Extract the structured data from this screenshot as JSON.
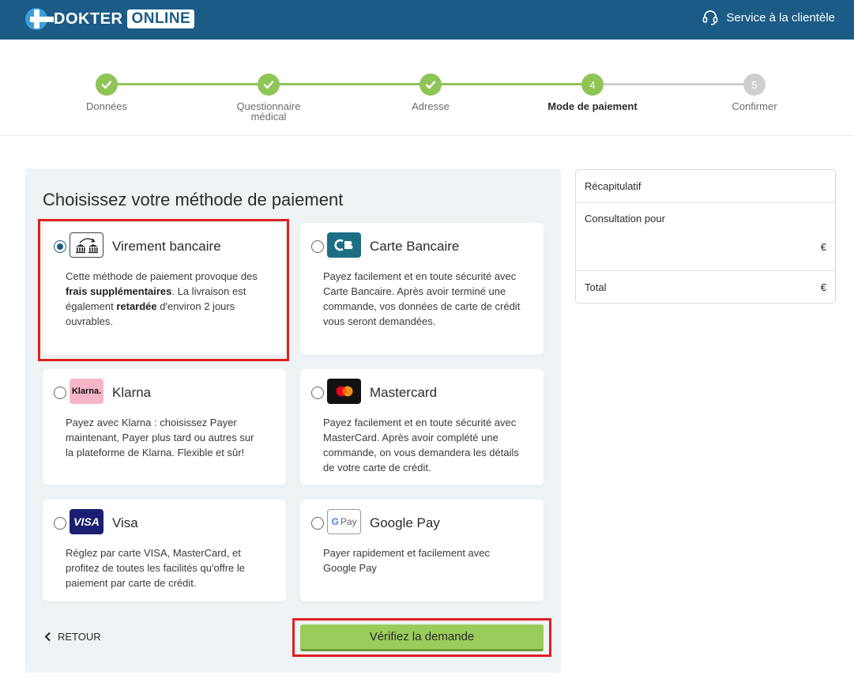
{
  "header": {
    "logo_word1": "DOKTER",
    "logo_word2": "ONLINE",
    "service_label": "Service à la clientèle",
    "bg_color": "#1b5b86"
  },
  "stepper": {
    "steps": [
      {
        "label": "Données",
        "state": "done",
        "num": "✓"
      },
      {
        "label": "Questionnaire médical",
        "state": "done",
        "num": "✓"
      },
      {
        "label": "Adresse",
        "state": "done",
        "num": "✓"
      },
      {
        "label": "Mode de paiement",
        "state": "active",
        "num": "4"
      },
      {
        "label": "Confirmer",
        "state": "todo",
        "num": "5"
      }
    ],
    "done_color": "#8fc457",
    "todo_color": "#cfcfcf"
  },
  "main": {
    "title": "Choisissez votre méthode de paiement",
    "methods": [
      {
        "name": "Virement bancaire",
        "icon": "bank-transfer-icon",
        "selected": true,
        "desc_parts": [
          "Cette méthode de paiement provoque des ",
          "frais supplémentaires",
          ". La livraison est également ",
          "retardée",
          " d'environ 2 jours ouvrables."
        ]
      },
      {
        "name": "Carte Bancaire",
        "icon": "carte-bancaire-icon",
        "selected": false,
        "desc": "Payez facilement et en toute sécurité avec Carte Bancaire. Après avoir terminé une commande, vos données de carte de crédit vous seront demandées."
      },
      {
        "name": "Klarna",
        "icon": "klarna-icon",
        "icon_text": "Klarna.",
        "selected": false,
        "desc": "Payez avec Klarna : choisissez Payer maintenant, Payer plus tard ou autres sur la plateforme de Klarna. Flexible et sûr!"
      },
      {
        "name": "Mastercard",
        "icon": "mastercard-icon",
        "selected": false,
        "desc": "Payez facilement et en toute sécurité avec MasterCard. Après avoir complété une commande, on vous demandera les détails de votre carte de crédit."
      },
      {
        "name": "Visa",
        "icon": "visa-icon",
        "icon_text": "VISA",
        "selected": false,
        "desc": "Réglez par carte VISA, MasterCard, et profitez de toutes les facilités qu'offre le paiement par carte de crédit."
      },
      {
        "name": "Google Pay",
        "icon": "google-pay-icon",
        "icon_text": "Pay",
        "selected": false,
        "desc": "Payer rapidement et facilement avec Google Pay"
      }
    ],
    "back_label": "RETOUR",
    "verify_label": "Vérifiez la demande",
    "button_color": "#9bcc5b",
    "highlight_color": "#e02020"
  },
  "summary": {
    "title": "Récapitulatif",
    "consult_label": "Consultation pour",
    "consult_price": "€",
    "total_label": "Total",
    "total_price": "€"
  }
}
